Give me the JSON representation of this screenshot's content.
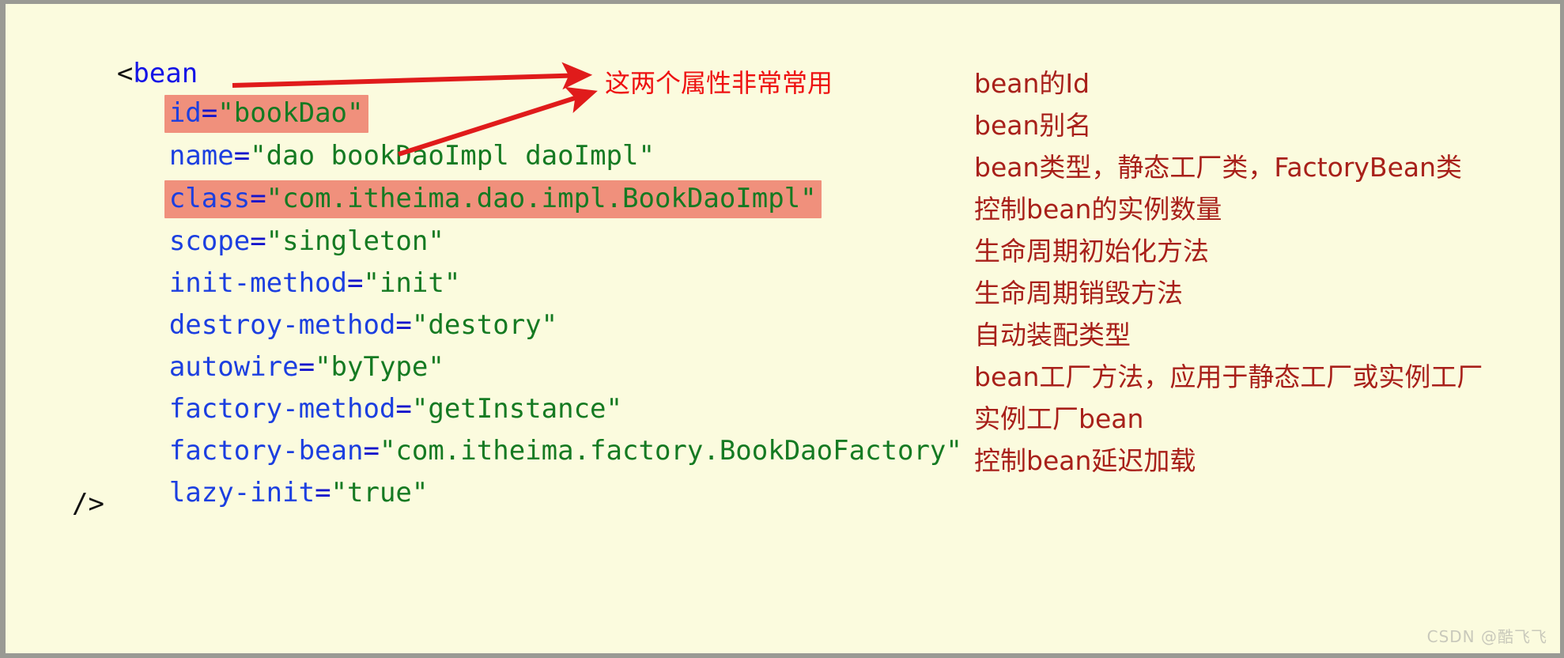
{
  "colors": {
    "background": "#FBFBDE",
    "border": "#9a9a94",
    "highlight": "#F0907C",
    "tag": "#1414e6",
    "attribute": "#1c3fe0",
    "value": "#157a22",
    "annotation": "#A8201A",
    "callout": "#EE1111"
  },
  "code": {
    "open_tag": {
      "bracket": "<",
      "name": "bean"
    },
    "close_tag": "/>",
    "lines": [
      {
        "attr": "id",
        "eq": "=",
        "value": "\"bookDao\"",
        "highlighted": true
      },
      {
        "attr": "name",
        "eq": "=",
        "value": "\"dao bookDaoImpl daoImpl\"",
        "highlighted": false
      },
      {
        "attr": "class",
        "eq": "=",
        "value": "\"com.itheima.dao.impl.BookDaoImpl\"",
        "highlighted": true
      },
      {
        "attr": "scope",
        "eq": "=",
        "value": "\"singleton\"",
        "highlighted": false
      },
      {
        "attr": "init-method",
        "eq": "=",
        "value": "\"init\"",
        "highlighted": false
      },
      {
        "attr": "destroy-method",
        "eq": "=",
        "value": "\"destory\"",
        "highlighted": false
      },
      {
        "attr": "autowire",
        "eq": "=",
        "value": "\"byType\"",
        "highlighted": false
      },
      {
        "attr": "factory-method",
        "eq": "=",
        "value": "\"getInstance\"",
        "highlighted": false
      },
      {
        "attr": "factory-bean",
        "eq": "=",
        "value": "\"com.itheima.factory.BookDaoFactory\"",
        "highlighted": false
      },
      {
        "attr": "lazy-init",
        "eq": "=",
        "value": "\"true\"",
        "highlighted": false
      }
    ]
  },
  "annotations": [
    "bean的Id",
    "bean别名",
    "bean类型，静态工厂类，FactoryBean类",
    "控制bean的实例数量",
    "生命周期初始化方法",
    "生命周期销毁方法",
    "自动装配类型",
    "bean工厂方法，应用于静态工厂或实例工厂",
    "实例工厂bean",
    "控制bean延迟加载"
  ],
  "callout": {
    "text": "这两个属性非常常用"
  },
  "watermark": {
    "text": "CSDN @酷飞飞"
  }
}
